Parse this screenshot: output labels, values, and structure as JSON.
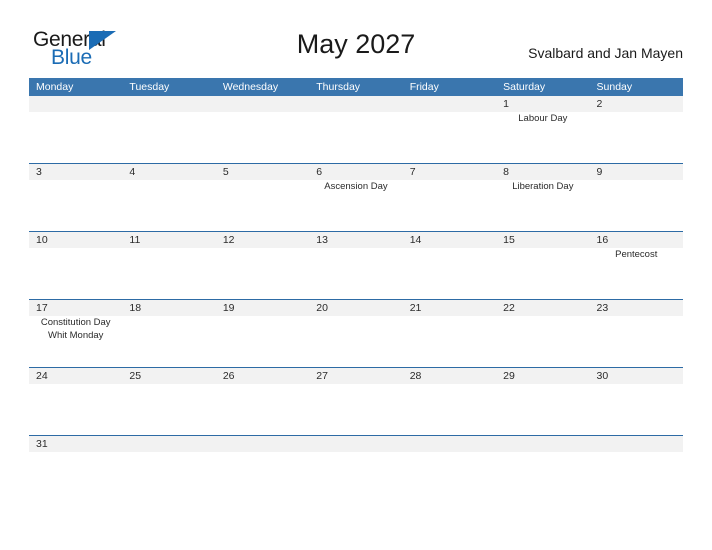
{
  "brand": {
    "name_part1": "General",
    "name_part2": "Blue",
    "triangle_icon": "triangle-icon",
    "accent_color": "#1b6cb5"
  },
  "header": {
    "title": "May 2027",
    "locale": "Svalbard and Jan Mayen"
  },
  "theme": {
    "header_blue": "#3a76ae",
    "rule_blue": "#2d6ba5",
    "date_band_gray": "#f2f2f2",
    "text_color": "#2b2b2b"
  },
  "calendar": {
    "month": "May",
    "year": "2027",
    "weekday_headers": [
      "Monday",
      "Tuesday",
      "Wednesday",
      "Thursday",
      "Friday",
      "Saturday",
      "Sunday"
    ],
    "weeks": [
      {
        "days": [
          {
            "date": "",
            "events": []
          },
          {
            "date": "",
            "events": []
          },
          {
            "date": "",
            "events": []
          },
          {
            "date": "",
            "events": []
          },
          {
            "date": "",
            "events": []
          },
          {
            "date": "1",
            "events": [
              "Labour Day"
            ]
          },
          {
            "date": "2",
            "events": []
          }
        ]
      },
      {
        "days": [
          {
            "date": "3",
            "events": []
          },
          {
            "date": "4",
            "events": []
          },
          {
            "date": "5",
            "events": []
          },
          {
            "date": "6",
            "events": [
              "Ascension Day"
            ]
          },
          {
            "date": "7",
            "events": []
          },
          {
            "date": "8",
            "events": [
              "Liberation Day"
            ]
          },
          {
            "date": "9",
            "events": []
          }
        ]
      },
      {
        "days": [
          {
            "date": "10",
            "events": []
          },
          {
            "date": "11",
            "events": []
          },
          {
            "date": "12",
            "events": []
          },
          {
            "date": "13",
            "events": []
          },
          {
            "date": "14",
            "events": []
          },
          {
            "date": "15",
            "events": []
          },
          {
            "date": "16",
            "events": [
              "Pentecost"
            ]
          }
        ]
      },
      {
        "days": [
          {
            "date": "17",
            "events": [
              "Constitution Day",
              "Whit Monday"
            ]
          },
          {
            "date": "18",
            "events": []
          },
          {
            "date": "19",
            "events": []
          },
          {
            "date": "20",
            "events": []
          },
          {
            "date": "21",
            "events": []
          },
          {
            "date": "22",
            "events": []
          },
          {
            "date": "23",
            "events": []
          }
        ]
      },
      {
        "days": [
          {
            "date": "24",
            "events": []
          },
          {
            "date": "25",
            "events": []
          },
          {
            "date": "26",
            "events": []
          },
          {
            "date": "27",
            "events": []
          },
          {
            "date": "28",
            "events": []
          },
          {
            "date": "29",
            "events": []
          },
          {
            "date": "30",
            "events": []
          }
        ]
      },
      {
        "days": [
          {
            "date": "31",
            "events": []
          },
          {
            "date": "",
            "events": []
          },
          {
            "date": "",
            "events": []
          },
          {
            "date": "",
            "events": []
          },
          {
            "date": "",
            "events": []
          },
          {
            "date": "",
            "events": []
          },
          {
            "date": "",
            "events": []
          }
        ]
      }
    ]
  }
}
